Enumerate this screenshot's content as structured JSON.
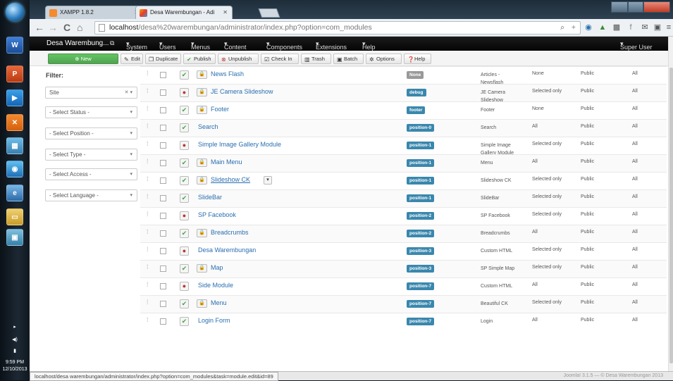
{
  "browser": {
    "tabs": [
      {
        "label": "XAMPP 1.8.2",
        "active": false
      },
      {
        "label": "Desa Warembungan - Adi",
        "active": true
      }
    ],
    "url_scheme": "localhost",
    "url_path": "/desa%20warembungan/administrator/index.php?option=com_modules"
  },
  "admin": {
    "site_name": "Desa Warembung...",
    "menu": [
      "System",
      "Users",
      "Menus",
      "Content",
      "Components",
      "Extensions",
      "Help"
    ],
    "user": "Super User"
  },
  "toolbar": {
    "new": "New",
    "edit": "Edit",
    "duplicate": "Duplicate",
    "publish": "Publish",
    "unpublish": "Unpublish",
    "checkin": "Check In",
    "trash": "Trash",
    "batch": "Batch",
    "options": "Options",
    "help": "Help"
  },
  "filters": {
    "title": "Filter:",
    "site": "Site",
    "status": "- Select Status -",
    "position": "- Select Position -",
    "type": "- Select Type -",
    "access": "- Select Access -",
    "language": "- Select Language -"
  },
  "modules": [
    {
      "title": "News Flash",
      "locked": true,
      "published": true,
      "position": "None",
      "type": "Articles - Newsflash",
      "pages": "None",
      "access": "Public",
      "lang": "All",
      "id": "82"
    },
    {
      "title": "JE Camera Slideshow",
      "locked": true,
      "published": false,
      "position": "debug",
      "type": "JE Camera Slideshow",
      "pages": "Selected only",
      "access": "Public",
      "lang": "All",
      "id": "92"
    },
    {
      "title": "Footer",
      "locked": true,
      "published": true,
      "position": "footer",
      "type": "Footer",
      "pages": "None",
      "access": "Public",
      "lang": "All",
      "id": "87"
    },
    {
      "title": "Search",
      "locked": false,
      "published": true,
      "position": "position-0",
      "type": "Search",
      "pages": "All",
      "access": "Public",
      "lang": "All",
      "id": "80"
    },
    {
      "title": "Simple Image Gallery Module",
      "locked": false,
      "published": false,
      "position": "position-1",
      "type": "Simple Image Gallery Module",
      "pages": "Selected only",
      "access": "Public",
      "lang": "All",
      "id": "95"
    },
    {
      "title": "Main Menu",
      "locked": true,
      "published": true,
      "position": "position-1",
      "type": "Menu",
      "pages": "All",
      "access": "Public",
      "lang": "All",
      "id": "1"
    },
    {
      "title": "Slideshow CK",
      "locked": true,
      "published": true,
      "position": "position-1",
      "type": "Slideshow CK",
      "pages": "Selected only",
      "access": "Public",
      "lang": "All",
      "id": "89"
    },
    {
      "title": "SlideBar",
      "locked": false,
      "published": true,
      "position": "position-1",
      "type": "SlideBar",
      "pages": "Selected only",
      "access": "Public",
      "lang": "All",
      "id": "96"
    },
    {
      "title": "SP Facebook",
      "locked": false,
      "published": false,
      "position": "position-2",
      "type": "SP Facebook",
      "pages": "Selected only",
      "access": "Public",
      "lang": "All",
      "id": "94"
    },
    {
      "title": "Breadcrumbs",
      "locked": true,
      "published": true,
      "position": "position-2",
      "type": "Breadcrumbs",
      "pages": "All",
      "access": "Public",
      "lang": "All",
      "id": "17"
    },
    {
      "title": "Desa Warembungan",
      "locked": false,
      "published": false,
      "position": "position-3",
      "type": "Custom HTML",
      "pages": "Selected only",
      "access": "Public",
      "lang": "All",
      "id": "88"
    },
    {
      "title": "Map",
      "locked": true,
      "published": true,
      "position": "position-3",
      "type": "SP Simple Map",
      "pages": "Selected only",
      "access": "Public",
      "lang": "All",
      "id": "93"
    },
    {
      "title": "Side Module",
      "locked": false,
      "published": false,
      "position": "position-7",
      "type": "Custom HTML",
      "pages": "All",
      "access": "Public",
      "lang": "All",
      "id": "83"
    },
    {
      "title": "Menu",
      "locked": true,
      "published": true,
      "position": "position-7",
      "type": "Beautiful CK",
      "pages": "Selected only",
      "access": "Public",
      "lang": "All",
      "id": "91"
    },
    {
      "title": "Login Form",
      "locked": false,
      "published": true,
      "position": "position-7",
      "type": "Login",
      "pages": "All",
      "access": "Public",
      "lang": "All",
      "id": "16"
    }
  ],
  "status": {
    "hover_url": "localhost/desa warembungan/administrator/index.php?option=com_modules&task=module.edit&id=89",
    "footer": "Joomla! 3.1.5 — © Desa Warembungan 2013"
  },
  "clock": {
    "time": "9:59 PM",
    "date": "12/10/2013"
  },
  "colors": {
    "accent": "#2a6fb0",
    "badge": "#3a87ad",
    "new_button": "#51a351",
    "admin_bar": "#050505"
  }
}
